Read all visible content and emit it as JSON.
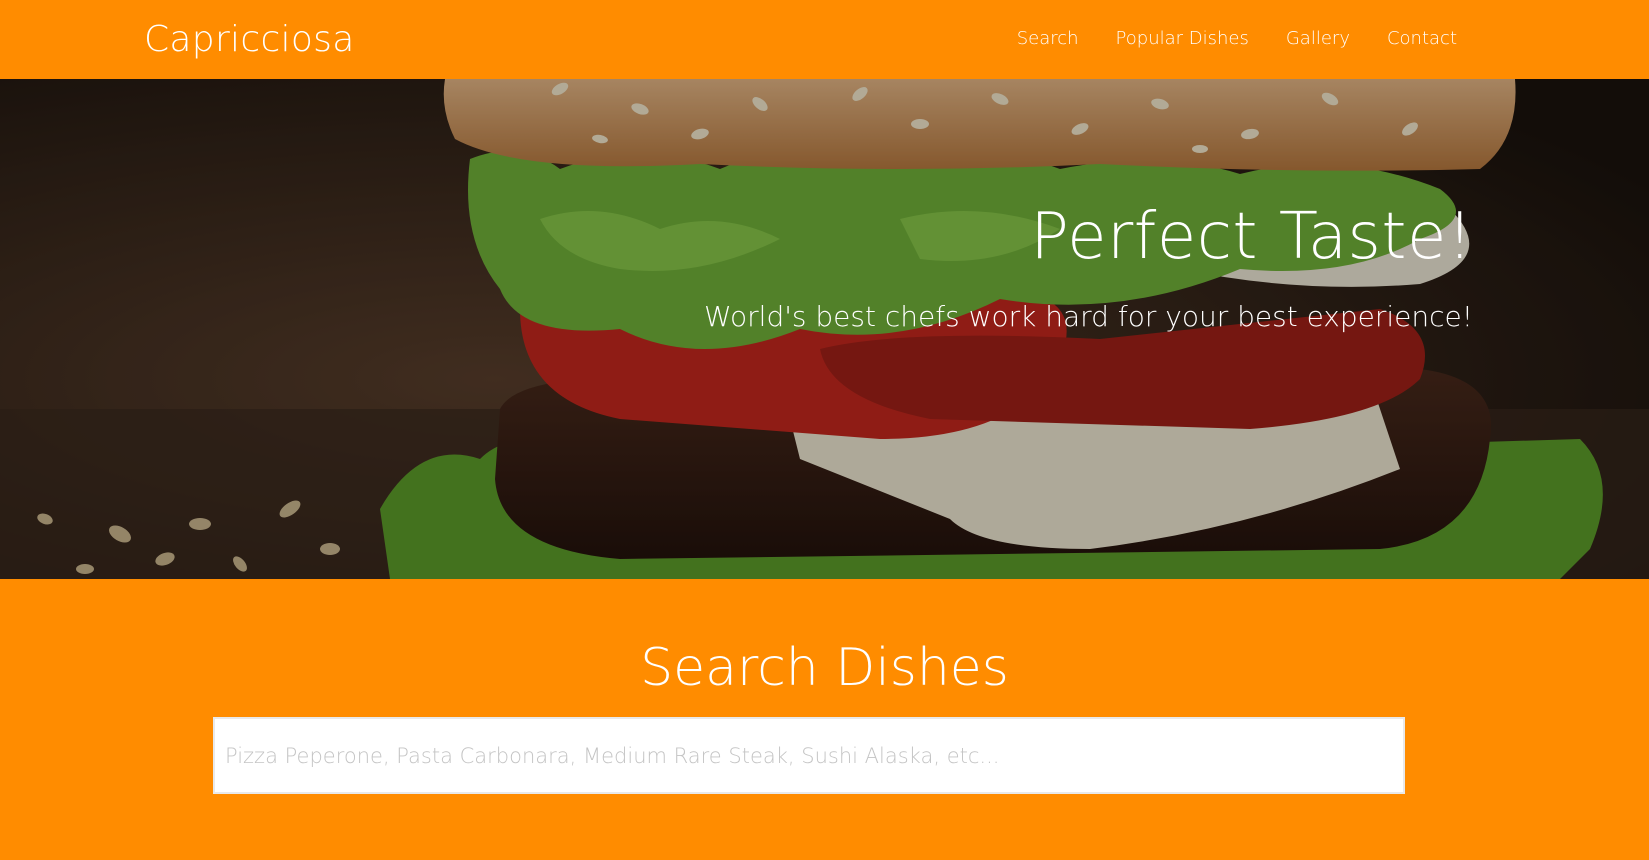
{
  "navbar": {
    "brand": "Capricciosa",
    "links": [
      "Search",
      "Popular Dishes",
      "Gallery",
      "Contact"
    ]
  },
  "hero": {
    "title": "Perfect Taste!",
    "subtitle": "World's best chefs work hard for your best experience!"
  },
  "search": {
    "title": "Search Dishes",
    "placeholder": "Pizza Peperone, Pasta Carbonara, Medium Rare Steak, Sushi Alaska, etc...",
    "value": ""
  },
  "colors": {
    "accent": "#ff8c00",
    "text": "#ffffff",
    "input_border": "#e9e9e9",
    "placeholder": "#c4c4c4"
  }
}
